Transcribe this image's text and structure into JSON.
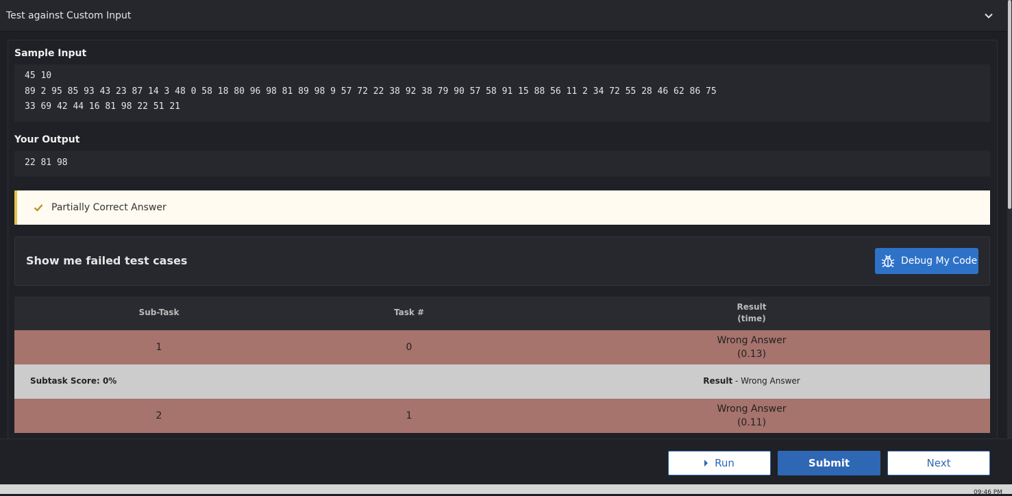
{
  "header": {
    "title": "Test against Custom Input"
  },
  "sample_input": {
    "label": "Sample Input",
    "lines": [
      "45 10",
      "89 2 95 85 93 43 23 87 14 3 48 0 58 18 80 96 98 81 89 98 9 57 72 22 38 92 38 79 90 57 58 91 15 88 56 11 2 34 72 55 28 46 62 86 75",
      "33 69 42 44 16 81 98 22 51 21"
    ]
  },
  "your_output": {
    "label": "Your Output",
    "value": "22 81 98"
  },
  "status": {
    "text": "Partially Correct Answer",
    "icon": "check-icon",
    "accent": "#e5c04a"
  },
  "failed_cases": {
    "title": "Show me failed test cases",
    "debug_label": "Debug My Code",
    "debug_icon": "bug-icon"
  },
  "table": {
    "headers": {
      "subtask": "Sub-Task",
      "task": "Task #",
      "result": "Result",
      "result_sub": "(time)"
    },
    "rows": [
      {
        "subtask": "1",
        "task": "0",
        "result": "Wrong Answer",
        "time": "(0.13)"
      },
      {
        "subtask": "2",
        "task": "1",
        "result": "Wrong Answer",
        "time": "(0.11)"
      }
    ],
    "score_row": {
      "score": "Subtask Score: 0%",
      "result_label": "Result",
      "result_value": " - Wrong Answer"
    },
    "fail_color": "#a6736d"
  },
  "footer": {
    "run_label": "Run",
    "submit_label": "Submit",
    "next_label": "Next"
  },
  "taskbar": {
    "clock": "09:46 PM"
  }
}
